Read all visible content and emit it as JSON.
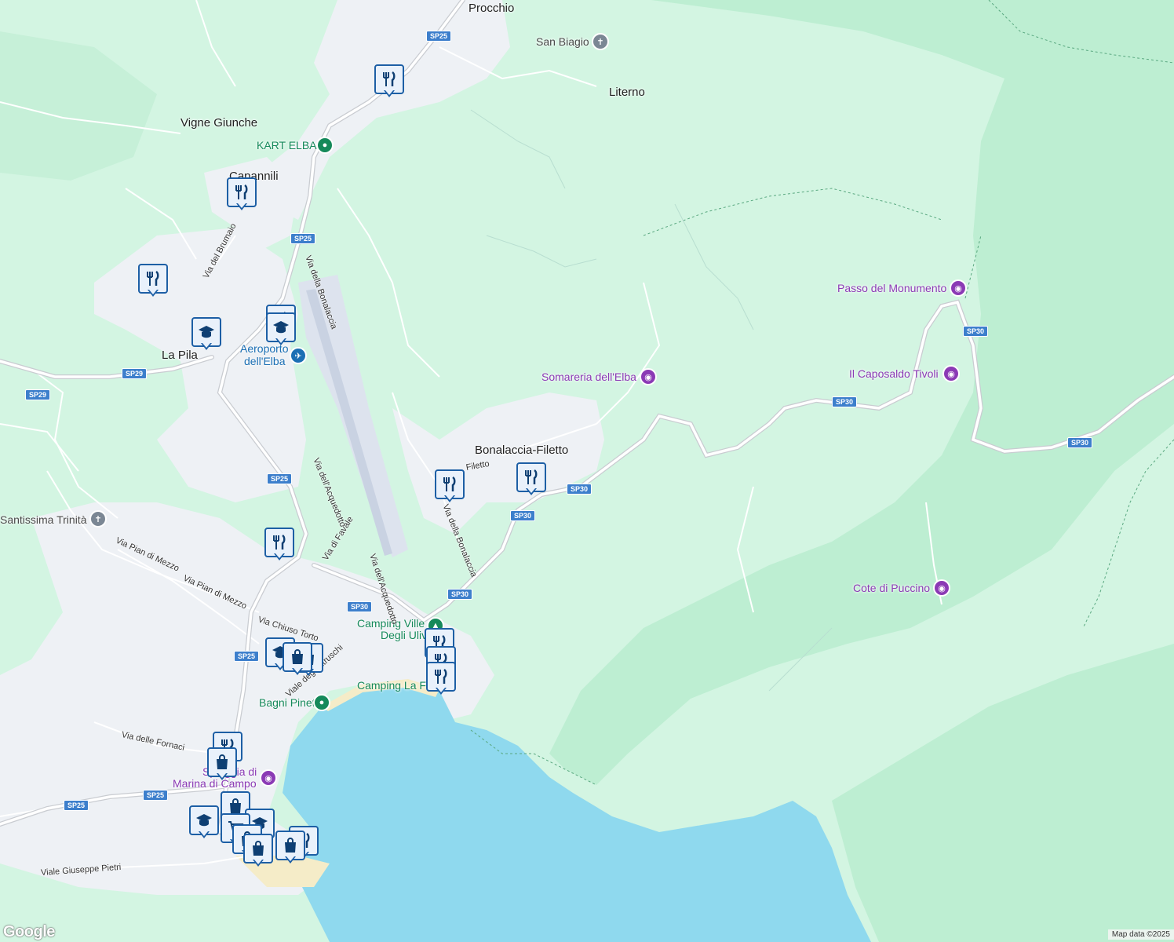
{
  "colors": {
    "land": "#d3f5e2",
    "forest": "#bdeed2",
    "urban": "#eef1f5",
    "water": "#8fd9ee",
    "road": "#ffffff",
    "major_road": "#c9ccd1",
    "runway": "#dde3ee",
    "marker_border": "#1d5fa5",
    "marker_fill": "#e9f1fb",
    "shield": "#3d7fcc",
    "poi_purple": "#8b3ab5",
    "poi_green": "#15895a"
  },
  "places": {
    "procchio": "Procchio",
    "san_biagio": "San Biagio",
    "literno": "Literno",
    "vigne_giunche": "Vigne Giunche",
    "kart_elba": "KART ELBA",
    "capannili": "Capannili",
    "la_pila": "La Pila",
    "aeroporto_1": "Aeroporto",
    "aeroporto_2": "dell'Elba",
    "passo_monumento": "Passo del Monumento",
    "somareria": "Somareria dell'Elba",
    "caposaldo": "Il Caposaldo Tivoli",
    "bonalaccia": "Bonalaccia-Filetto",
    "santissima": "Santissima Trinità",
    "cote_puccino": "Cote di Puccino",
    "camping_ville_1": "Camping Ville",
    "camping_ville_2": "Degli Ulivi",
    "camping_foce": "Camping La Foce",
    "bagni_pineta": "Bagni Pineta",
    "spiaggia_1": "Spiaggia di",
    "spiaggia_2": "Marina di Campo"
  },
  "streets": {
    "via_brumaio": "Via del Brumaio",
    "via_bonalaccia_1": "Via della Bonalaccia",
    "via_bonalaccia_2": "Via della Bonalaccia",
    "via_filetto": "Filetto",
    "via_acquedotto_1": "Via dell'Acquedotto",
    "via_acquedotto_2": "Via dell'Acquedotto",
    "via_favale": "Via di Favale",
    "via_pian_1": "Via Pian di Mezzo",
    "via_pian_2": "Via Pian di Mezzo",
    "via_chiuso": "Via Chiuso Torto",
    "viale_etruschi": "Viale degli Etruschi",
    "via_fornaci": "Via delle Fornaci",
    "viale_pietri": "Viale Giuseppe Pietri"
  },
  "shields": {
    "sp25": "SP25",
    "sp29": "SP29",
    "sp30": "SP30"
  },
  "markers": {
    "restaurant": "restaurant-icon",
    "school": "school-icon",
    "shopping": "shopping-bag-icon",
    "cart": "shopping-cart-icon"
  },
  "footer": {
    "logo": "Google",
    "attribution": "Map data ©2025"
  }
}
